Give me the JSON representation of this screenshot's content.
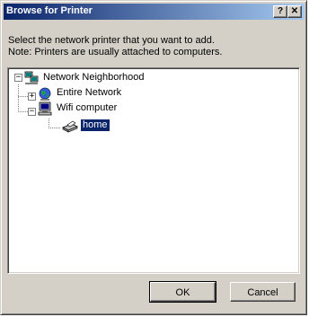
{
  "window": {
    "title": "Browse for Printer"
  },
  "titlebar": {
    "help_label": "?",
    "close_label": "✕"
  },
  "prompt": {
    "line1": "Select the network printer that you want to add.",
    "line2": "Note: Printers are usually attached to computers."
  },
  "tree": {
    "root": {
      "label": "Network Neighborhood",
      "expander": "−",
      "icon": "network-neighborhood-icon"
    },
    "entire_network": {
      "label": "Entire Network",
      "expander": "+",
      "icon": "globe-icon"
    },
    "computer": {
      "label": "Wifi computer",
      "expander": "−",
      "icon": "computer-icon"
    },
    "printer": {
      "label": "home",
      "icon": "printer-icon",
      "selected": true
    }
  },
  "buttons": {
    "ok": "OK",
    "cancel": "Cancel"
  },
  "colors": {
    "titlebar_start": "#0a246a",
    "titlebar_end": "#a6caf0",
    "face": "#d4d0c8",
    "selection": "#0a246a"
  }
}
